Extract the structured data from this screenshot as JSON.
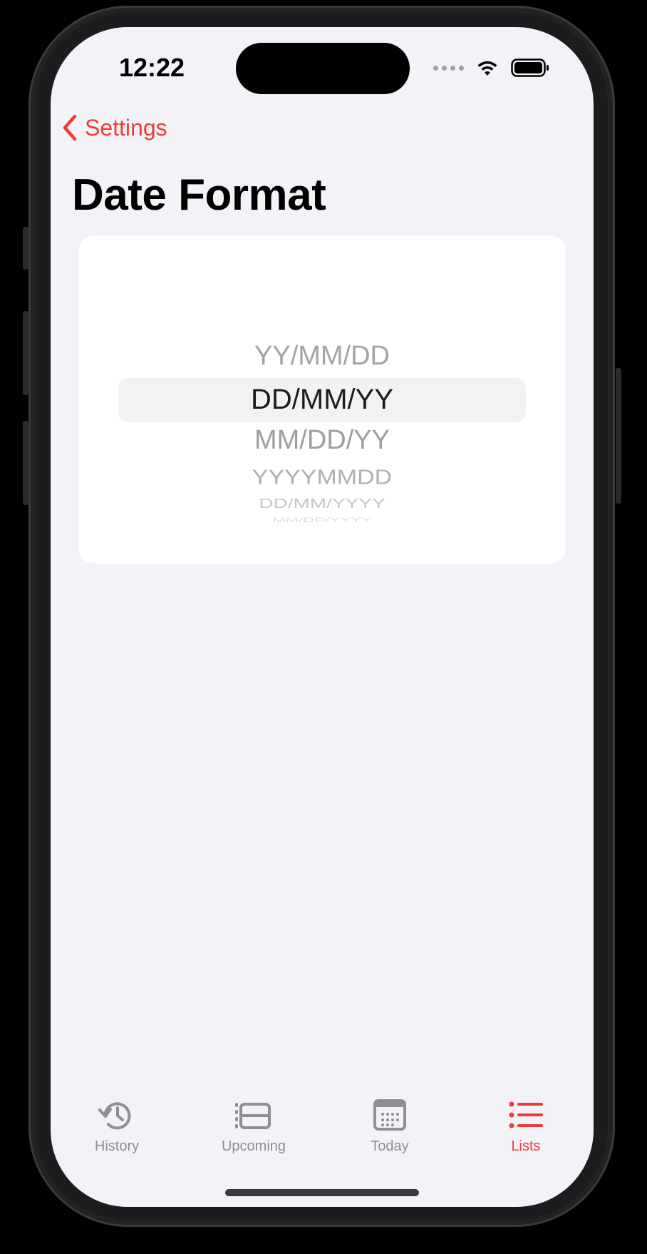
{
  "status_bar": {
    "time": "12:22",
    "signal_icon": "signal-dots-icon",
    "wifi_icon": "wifi-icon",
    "battery_icon": "battery-icon"
  },
  "nav": {
    "back_label": "Settings",
    "back_icon": "chevron-left-icon"
  },
  "page": {
    "title": "Date Format"
  },
  "picker": {
    "options": [
      "YY/MM/DD",
      "DD/MM/YY",
      "MM/DD/YY",
      "YYYYMMDD",
      "DD/MM/YYYY",
      "MM/DD/YYYY"
    ],
    "selected": "DD/MM/YY"
  },
  "tab_bar": {
    "tabs": [
      {
        "label": "History",
        "icon": "history-icon"
      },
      {
        "label": "Upcoming",
        "icon": "upcoming-icon"
      },
      {
        "label": "Today",
        "icon": "calendar-icon"
      },
      {
        "label": "Lists",
        "icon": "list-icon"
      }
    ],
    "active": "Lists"
  },
  "colors": {
    "accent": "#ef3b3b",
    "background": "#f2f2f7",
    "card": "#ffffff",
    "inactive": "#8e8e93"
  }
}
